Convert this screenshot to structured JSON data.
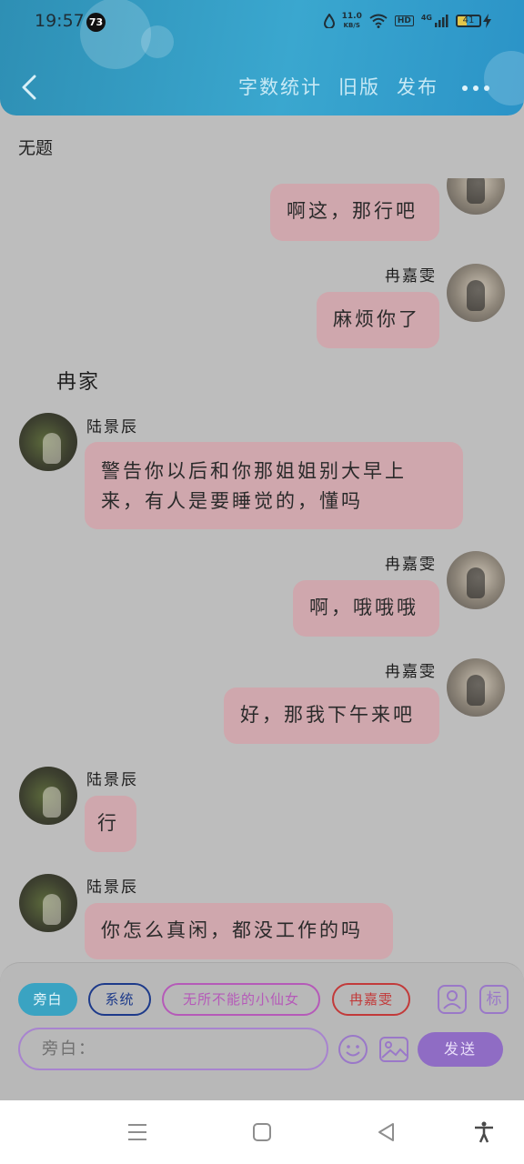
{
  "status_bar": {
    "time": "19:57",
    "notification_count": "73",
    "net_speed_value": "11.0",
    "net_speed_unit": "KB/S",
    "hd_label": "HD",
    "network_label": "4G",
    "battery_level": "41"
  },
  "header": {
    "actions": [
      "字数统计",
      "旧版",
      "发布"
    ]
  },
  "chat": {
    "title": "无题",
    "scene_label": "冉家",
    "messages": [
      {
        "side": "right",
        "sender": "",
        "text": "啊这，那行吧"
      },
      {
        "side": "right",
        "sender": "冉嘉雯",
        "text": "麻烦你了"
      },
      {
        "side": "left",
        "sender": "陆景辰",
        "text_line1": "警告你以后和你那姐姐别大早上",
        "text_line2": "来，有人是要睡觉的，懂吗"
      },
      {
        "side": "right",
        "sender": "冉嘉雯",
        "text": "啊，哦哦哦"
      },
      {
        "side": "right",
        "sender": "冉嘉雯",
        "text": "好，那我下午来吧"
      },
      {
        "side": "left",
        "sender": "陆景辰",
        "text": "行"
      },
      {
        "side": "left",
        "sender": "陆景辰",
        "text": "你怎么真闲，都没工作的吗"
      }
    ]
  },
  "composer": {
    "roles": [
      "旁白",
      "系统",
      "无所不能的小仙女",
      "冉嘉雯"
    ],
    "tool_label": "标",
    "input_placeholder": "旁白：",
    "send_label": "发送"
  },
  "colors": {
    "header_accent": "#3aa7cf",
    "bubble": "#cfa7ad",
    "send": "#8f6cc4"
  }
}
